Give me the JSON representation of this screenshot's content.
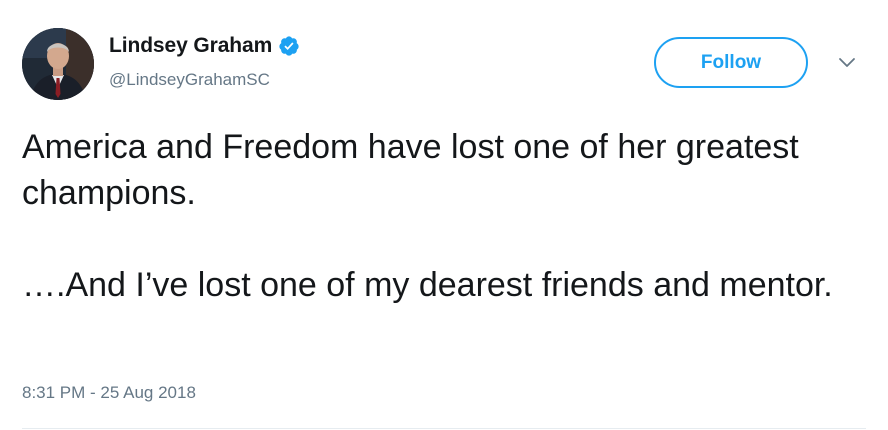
{
  "author": {
    "display_name": "Lindsey Graham",
    "handle": "@LindseyGrahamSC",
    "verified": true,
    "avatar_icon": "profile-photo"
  },
  "actions": {
    "follow_label": "Follow",
    "more_icon": "chevron-down-icon"
  },
  "tweet": {
    "paragraphs": [
      "America and Freedom have lost one of her greatest champions.",
      "….And I’ve lost one of my dearest friends and mentor."
    ],
    "timestamp": "8:31 PM - 25 Aug 2018"
  },
  "colors": {
    "accent": "#1da1f2",
    "text": "#14171a",
    "secondary_text": "#657786"
  }
}
